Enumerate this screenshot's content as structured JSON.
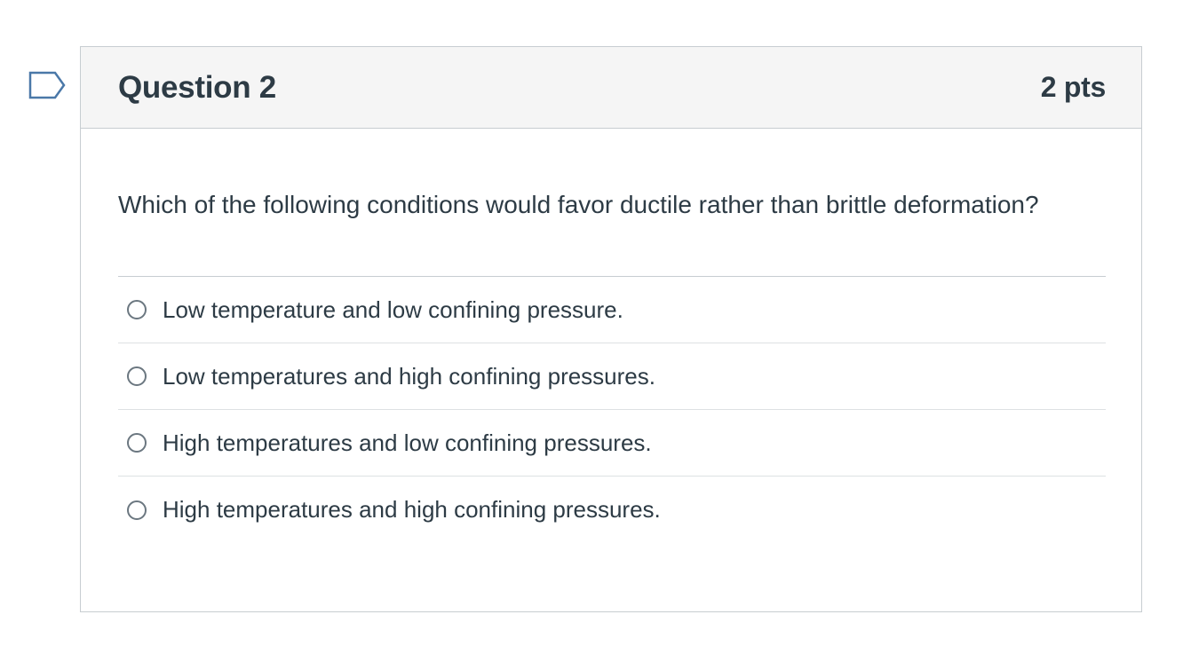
{
  "flag": {
    "icon": "flag-question-icon",
    "color": "#4a78a8"
  },
  "question": {
    "title": "Question 2",
    "points": "2 pts",
    "text": "Which of the following conditions would favor ductile rather than brittle deformation?",
    "answers": [
      {
        "label": "Low temperature and low confining pressure.",
        "selected": false
      },
      {
        "label": "Low temperatures and high confining pressures.",
        "selected": false
      },
      {
        "label": "High temperatures and low confining pressures.",
        "selected": false
      },
      {
        "label": "High temperatures and high confining pressures.",
        "selected": false
      }
    ]
  }
}
